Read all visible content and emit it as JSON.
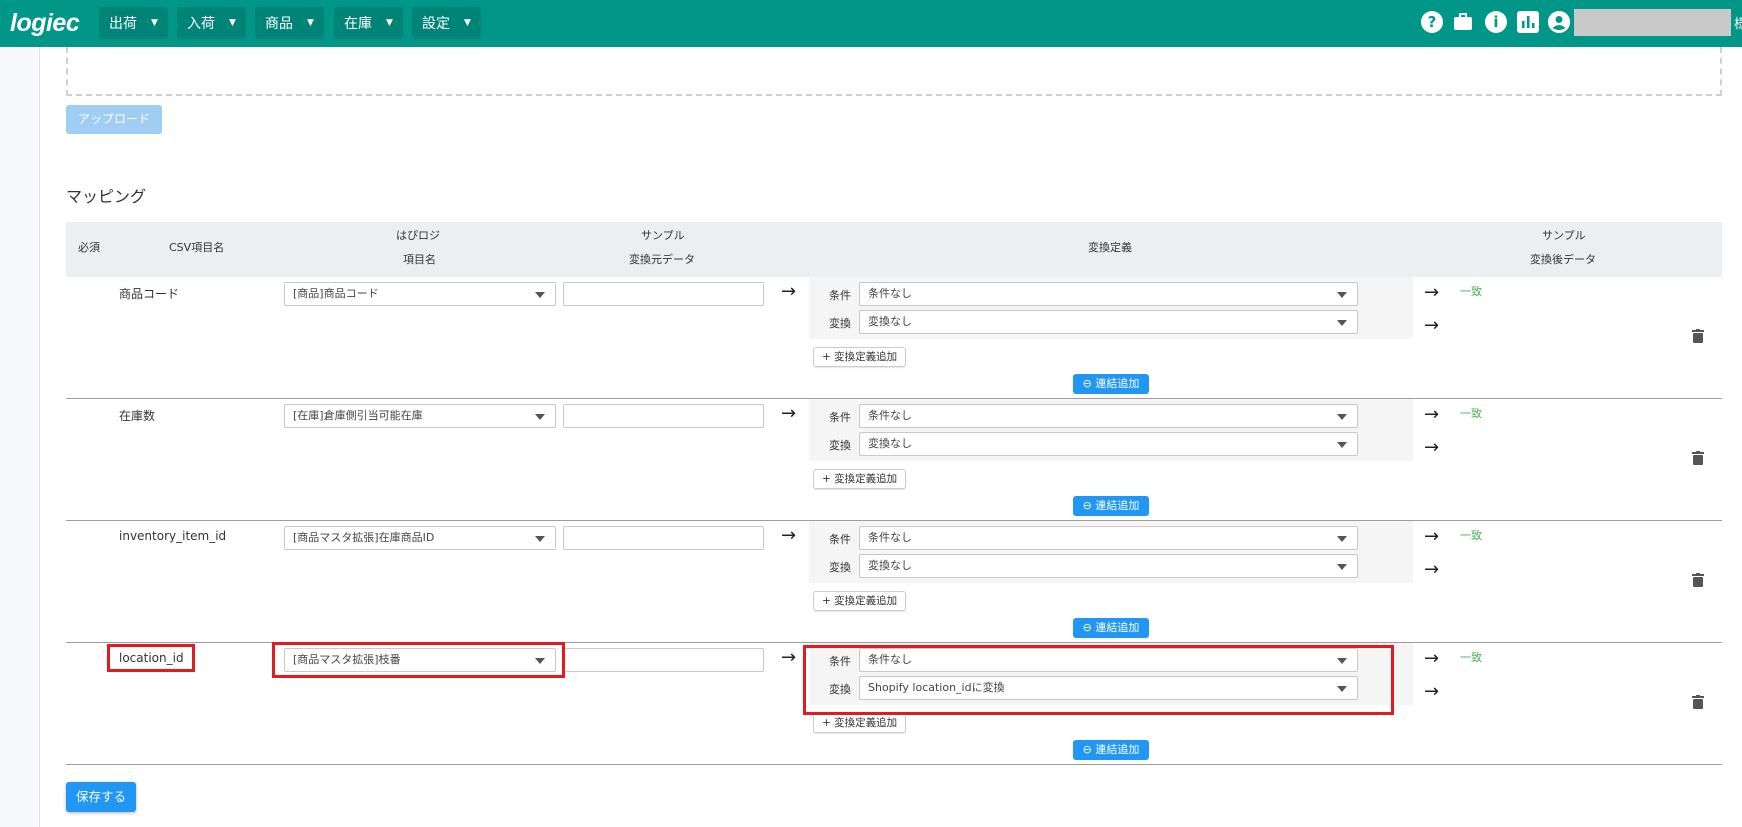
{
  "app": {
    "logo": "logiec"
  },
  "nav": [
    {
      "label": "出荷"
    },
    {
      "label": "入荷"
    },
    {
      "label": "商品"
    },
    {
      "label": "在庫"
    },
    {
      "label": "設定"
    }
  ],
  "top_icons": [
    "help-icon",
    "briefcase-icon",
    "info-icon",
    "chart-icon",
    "account-icon"
  ],
  "top_cut_text": "様",
  "upload_label": "アップロード",
  "section_title": "マッピング",
  "table_header": {
    "required": "必須",
    "csv_item": "CSV項目名",
    "logi_item_1": "はぴロジ",
    "logi_item_2": "項目名",
    "sample_src_1": "サンプル",
    "sample_src_2": "変換元データ",
    "conversion": "変換定義",
    "sample_dst_1": "サンプル",
    "sample_dst_2": "変換後データ"
  },
  "conv_labels": {
    "condition": "条件",
    "transform": "変換"
  },
  "add_definition_label": "+ 変換定義追加",
  "link_add_label": "⊖ 連結追加",
  "rows": [
    {
      "csv": "商品コード",
      "item": "[商品]商品コード",
      "condition": "条件なし",
      "transform": "変換なし",
      "result": "一致"
    },
    {
      "csv": "在庫数",
      "item": "[在庫]倉庫側引当可能在庫",
      "condition": "条件なし",
      "transform": "変換なし",
      "result": "一致"
    },
    {
      "csv": "inventory_item_id",
      "item": "[商品マスタ拡張]在庫商品ID",
      "condition": "条件なし",
      "transform": "変換なし",
      "result": "一致"
    },
    {
      "csv": "location_id",
      "item": "[商品マスタ拡張]枝番",
      "condition": "条件なし",
      "transform": "Shopify location_idに変換",
      "result": "一致"
    }
  ],
  "save_label": "保存する",
  "colors": {
    "header": "#009788",
    "primary": "#2196f3",
    "highlight": "#e21b23",
    "match": "#4caf50"
  }
}
